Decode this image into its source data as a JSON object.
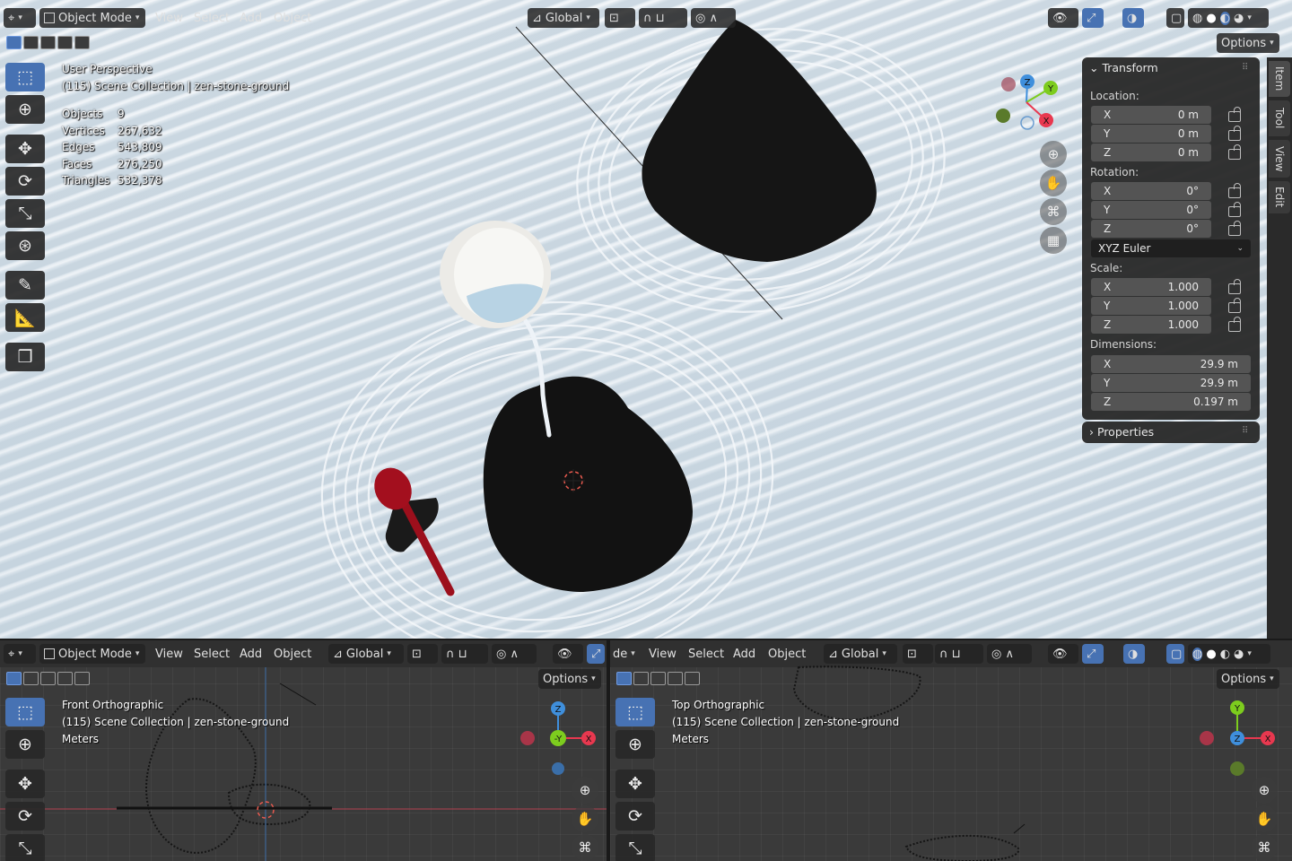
{
  "main_viewport": {
    "header": {
      "mode": "Object Mode",
      "menus": [
        "View",
        "Select",
        "Add",
        "Object"
      ],
      "orientation": "Global",
      "options": "Options"
    },
    "overlay": {
      "view_name": "User Perspective",
      "collection": "(115) Scene Collection | zen-stone-ground"
    },
    "stats": [
      {
        "label": "Objects",
        "value": "9"
      },
      {
        "label": "Vertices",
        "value": "267,632"
      },
      {
        "label": "Edges",
        "value": "543,809"
      },
      {
        "label": "Faces",
        "value": "276,250"
      },
      {
        "label": "Triangles",
        "value": "532,378"
      }
    ],
    "gizmo": {
      "x": "X",
      "y": "Y",
      "z": "Z"
    }
  },
  "sidebar": {
    "tabs": [
      "Item",
      "Tool",
      "View",
      "Edit"
    ],
    "transform_title": "Transform",
    "location_label": "Location:",
    "location": [
      {
        "axis": "X",
        "value": "0 m"
      },
      {
        "axis": "Y",
        "value": "0 m"
      },
      {
        "axis": "Z",
        "value": "0 m"
      }
    ],
    "rotation_label": "Rotation:",
    "rotation": [
      {
        "axis": "X",
        "value": "0°"
      },
      {
        "axis": "Y",
        "value": "0°"
      },
      {
        "axis": "Z",
        "value": "0°"
      }
    ],
    "rotation_mode": "XYZ Euler",
    "scale_label": "Scale:",
    "scale": [
      {
        "axis": "X",
        "value": "1.000"
      },
      {
        "axis": "Y",
        "value": "1.000"
      },
      {
        "axis": "Z",
        "value": "1.000"
      }
    ],
    "dimensions_label": "Dimensions:",
    "dimensions": [
      {
        "axis": "X",
        "value": "29.9 m"
      },
      {
        "axis": "Y",
        "value": "29.9 m"
      },
      {
        "axis": "Z",
        "value": "0.197 m"
      }
    ],
    "properties_title": "Properties"
  },
  "front_view": {
    "header": {
      "mode": "Object Mode",
      "menus": [
        "View",
        "Select",
        "Add",
        "Object"
      ],
      "orientation": "Global",
      "options": "Options"
    },
    "view_name": "Front Orthographic",
    "collection": "(115) Scene Collection | zen-stone-ground",
    "units": "Meters",
    "gizmo": {
      "x": "X",
      "y": "-Y",
      "z": "Z"
    }
  },
  "top_view": {
    "header": {
      "mode": "de",
      "menus": [
        "View",
        "Select",
        "Add",
        "Object"
      ],
      "orientation": "Global",
      "options": "Options"
    },
    "view_name": "Top Orthographic",
    "collection": "(115) Scene Collection | zen-stone-ground",
    "units": "Meters",
    "gizmo": {
      "x": "X",
      "y": "Y",
      "z": "Z"
    }
  },
  "colors": {
    "accent": "#4772b3",
    "axis_x": "#e8384f",
    "axis_y": "#7dcc1e",
    "axis_z": "#3f8fdc",
    "spoon": "#9c0f1c"
  }
}
